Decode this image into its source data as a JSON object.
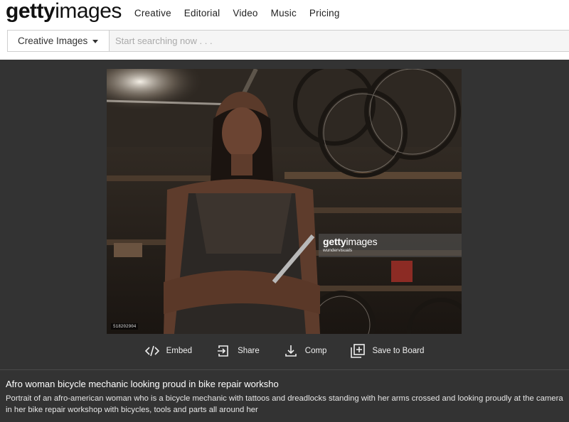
{
  "logo": {
    "bold": "getty",
    "light": "images"
  },
  "nav": {
    "links": [
      "Creative",
      "Editorial",
      "Video",
      "Music",
      "Pricing"
    ]
  },
  "search": {
    "scope_label": "Creative Images",
    "placeholder": "Start searching now . . ."
  },
  "image": {
    "watermark_bold": "getty",
    "watermark_light": "images",
    "watermark_credit": "wundervisuals",
    "image_id": "518202904"
  },
  "actions": {
    "embed": "Embed",
    "share": "Share",
    "comp": "Comp",
    "save": "Save to Board"
  },
  "details": {
    "title": "Afro woman bicycle mechanic looking proud in bike repair worksho",
    "description": "Portrait of an afro-american woman who is a bicycle mechanic with tattoos and dreadlocks standing with her arms crossed and looking proudly at the camera in her bike repair workshop with bicycles, tools and parts all around her"
  },
  "colors": {
    "viewer_bg": "#333333",
    "nav_bg": "#ffffff"
  }
}
